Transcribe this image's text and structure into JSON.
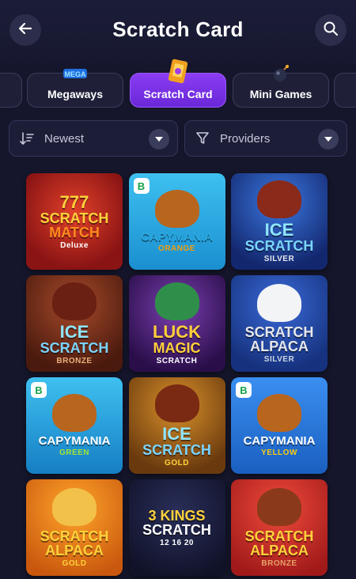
{
  "header": {
    "title": "Scratch Card"
  },
  "tabs": [
    {
      "label": ""
    },
    {
      "label": "Megaways",
      "icon": "megaways-icon",
      "icon_text": "MEGA"
    },
    {
      "label": "Scratch Card",
      "icon": "scratch-card-icon",
      "active": true
    },
    {
      "label": "Mini Games",
      "icon": "bomb-icon"
    },
    {
      "label": ""
    }
  ],
  "filters": {
    "sort": {
      "label": "Newest",
      "icon": "sort-descending-icon"
    },
    "providers": {
      "label": "Providers",
      "icon": "funnel-icon"
    }
  },
  "games": [
    {
      "l1": "SCRATCH",
      "l2": "MATCH",
      "l3": "Deluxe",
      "top": "777",
      "badge": ""
    },
    {
      "l1": "",
      "l2": "CAPYMANIA",
      "l3": "ORANGE",
      "top": "",
      "badge": "B"
    },
    {
      "l1": "ICE",
      "l2": "SCRATCH",
      "l3": "SILVER",
      "top": "",
      "badge": ""
    },
    {
      "l1": "ICE",
      "l2": "SCRATCH",
      "l3": "BRONZE",
      "top": "",
      "badge": ""
    },
    {
      "l1": "LUCK",
      "l2": "MAGIC",
      "l3": "SCRATCH",
      "top": "",
      "badge": ""
    },
    {
      "l1": "SCRATCH",
      "l2": "ALPACA",
      "l3": "SILVER",
      "top": "",
      "badge": ""
    },
    {
      "l1": "",
      "l2": "CAPYMANIA",
      "l3": "GREEN",
      "top": "",
      "badge": "B"
    },
    {
      "l1": "ICE",
      "l2": "SCRATCH",
      "l3": "GOLD",
      "top": "",
      "badge": ""
    },
    {
      "l1": "",
      "l2": "CAPYMANIA",
      "l3": "YELLOW",
      "top": "",
      "badge": "B"
    },
    {
      "l1": "SCRATCH",
      "l2": "ALPACA",
      "l3": "GOLD",
      "top": "",
      "badge": ""
    },
    {
      "l1": "3 KINGS",
      "l2": "SCRATCH",
      "l3": "12  16  20",
      "top": "",
      "badge": ""
    },
    {
      "l1": "SCRATCH",
      "l2": "ALPACA",
      "l3": "BRONZE",
      "top": "",
      "badge": ""
    }
  ],
  "colors": {
    "background": "#15162b",
    "accent": "#7c3aed",
    "card_bgs": [
      "#9b1c1c",
      "#2aa8e0",
      "#1e4fb0",
      "#7a2d1a",
      "#4b1d7a",
      "#1f3f9e",
      "#1e7fc9",
      "#a8641a",
      "#1f6fd0",
      "#e07a12",
      "#1a1d3a",
      "#d62f2f"
    ]
  }
}
